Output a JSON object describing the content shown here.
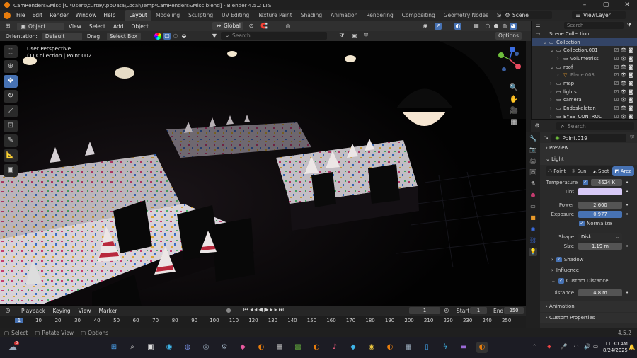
{
  "title_bar": {
    "text": "CamRenders&Misc [C:\\Users\\curte\\AppData\\Local\\Temp\\CamRenders&Misc.blend] - Blender 4.5.2 LTS"
  },
  "menu": {
    "items": [
      "File",
      "Edit",
      "Render",
      "Window",
      "Help"
    ],
    "workspaces": [
      "Layout",
      "Modeling",
      "Sculpting",
      "UV Editing",
      "Texture Paint",
      "Shading",
      "Animation",
      "Rendering",
      "Compositing",
      "Geometry Nodes",
      "Scripting"
    ],
    "active_workspace": "Layout",
    "scene": "Scene",
    "view_layer": "ViewLayer"
  },
  "header": {
    "mode": "Object Mode",
    "menus": [
      "View",
      "Select",
      "Add",
      "Object"
    ],
    "transform": "Global",
    "search_placeholder": "Search",
    "orientation_label": "Orientation:",
    "orientation_value": "Default",
    "drag_label": "Drag:",
    "drag_value": "Select Box",
    "options": "Options"
  },
  "viewport": {
    "perspective": "User Perspective",
    "collection_path": "(1) Collection | Point.002"
  },
  "outliner": {
    "search_placeholder": "Search",
    "items": [
      {
        "name": "Scene Collection",
        "indent": 0
      },
      {
        "name": "Collection",
        "indent": 1
      },
      {
        "name": "Collection.001",
        "indent": 2
      },
      {
        "name": "volumetrics",
        "indent": 3
      },
      {
        "name": "roof",
        "indent": 2
      },
      {
        "name": "Plane.003",
        "indent": 3
      },
      {
        "name": "map",
        "indent": 2
      },
      {
        "name": "lights",
        "indent": 2
      },
      {
        "name": "camera",
        "indent": 2
      },
      {
        "name": "Endoskeleton",
        "indent": 2
      },
      {
        "name": "EYES_CONTROL",
        "indent": 2
      }
    ]
  },
  "properties": {
    "search_placeholder": "Search",
    "object_name": "Point.019",
    "panels": {
      "preview": "Preview",
      "light": "Light",
      "shadow": "Shadow",
      "influence": "Influence",
      "custom_distance": "Custom Distance",
      "animation": "Animation",
      "custom_properties": "Custom Properties"
    },
    "light_types": [
      "Point",
      "Sun",
      "Spot",
      "Area"
    ],
    "active_light_type": "Area",
    "temperature_label": "Temperature",
    "temperature_value": "4624 K",
    "tint_label": "Tint",
    "tint_color": "#d7c9f6",
    "power_label": "Power",
    "power_value": "2.600",
    "exposure_label": "Exposure",
    "exposure_value": "0.977",
    "normalize_label": "Normalize",
    "shape_label": "Shape",
    "shape_value": "Disk",
    "size_label": "Size",
    "size_value": "1.19 m",
    "distance_label": "Distance",
    "distance_value": "4.8 m"
  },
  "timeline": {
    "menus": [
      "Playback",
      "Keying",
      "View",
      "Marker"
    ],
    "current_frame": "1",
    "start_label": "Start",
    "start_value": "1",
    "end_label": "End",
    "end_value": "250",
    "ticks": [
      "1",
      "10",
      "20",
      "30",
      "40",
      "50",
      "60",
      "70",
      "80",
      "90",
      "100",
      "110",
      "120",
      "130",
      "140",
      "150",
      "160",
      "170",
      "180",
      "190",
      "200",
      "210",
      "220",
      "230",
      "240",
      "250"
    ]
  },
  "status_bar": {
    "select": "Select",
    "rotate": "Rotate View",
    "options": "Options",
    "version": "4.5.2"
  },
  "taskbar": {
    "badge": "3",
    "time": "11:30 AM",
    "date": "8/24/2025"
  },
  "colors": {
    "accent": "#4772b3",
    "header": "#303030",
    "viewport_bg": "#050505"
  }
}
